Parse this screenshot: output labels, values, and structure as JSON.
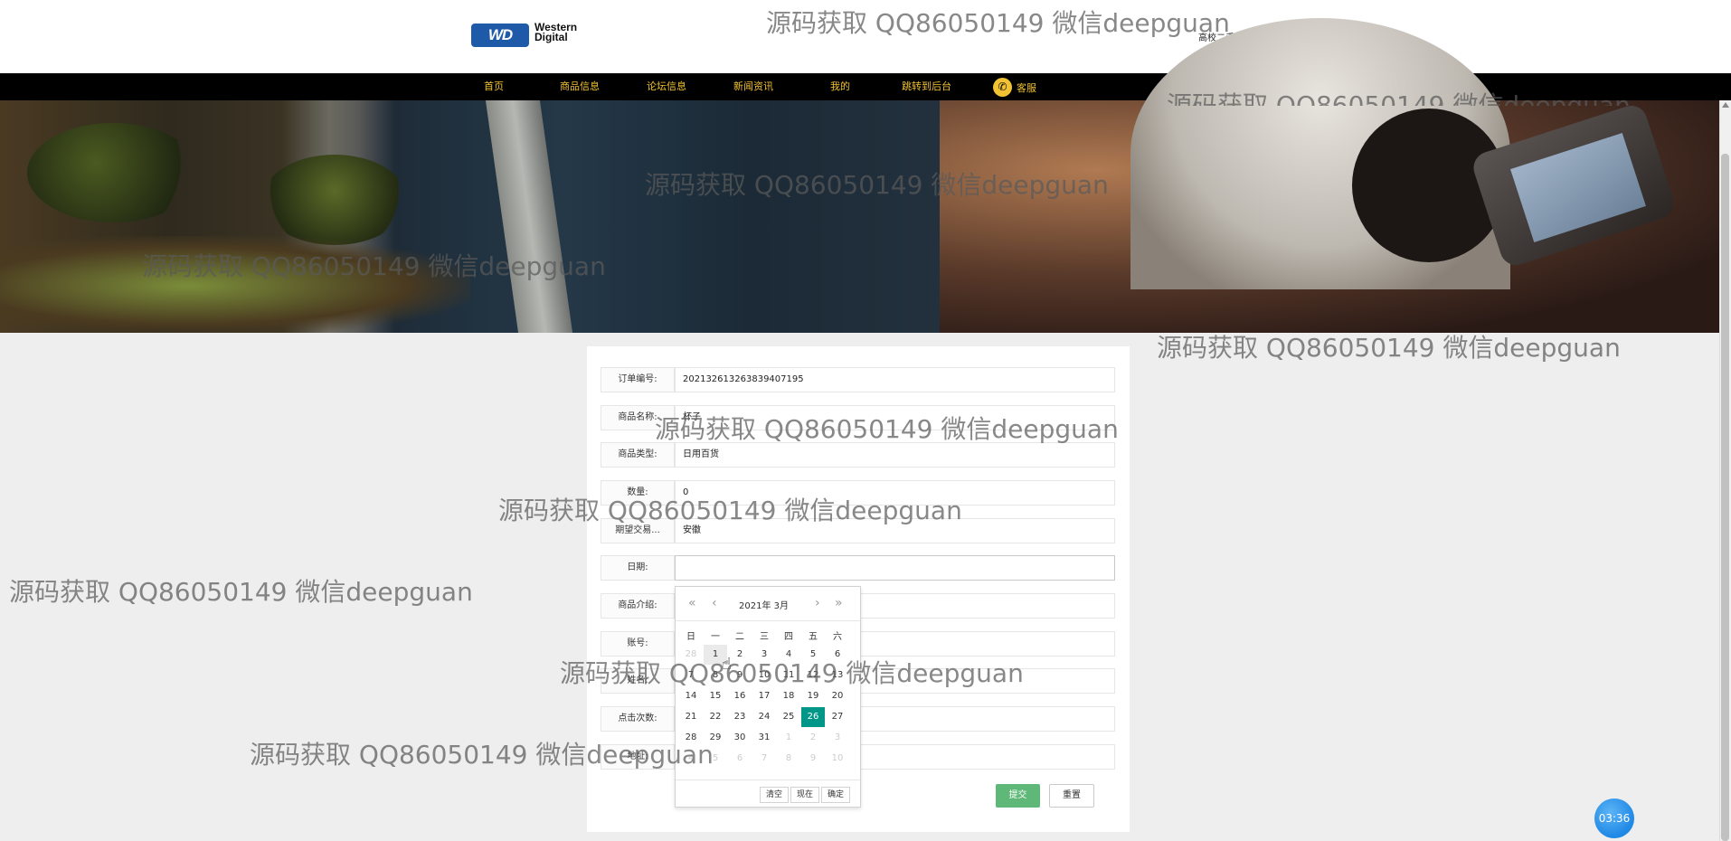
{
  "header": {
    "logo_text": "WD",
    "logo_brand_line1": "Western",
    "logo_brand_line2": "Digital",
    "site_name": "高校二手交易平台"
  },
  "nav": {
    "items": [
      {
        "label": "首页"
      },
      {
        "label": "商品信息"
      },
      {
        "label": "论坛信息"
      },
      {
        "label": "新闻资讯"
      },
      {
        "label": "我的"
      },
      {
        "label": "跳转到后台"
      }
    ],
    "service_label": "客服"
  },
  "form": {
    "fields": [
      {
        "label": "订单编号:",
        "value": "20213261326383940719​5"
      },
      {
        "label": "商品名称:",
        "value": "杯子"
      },
      {
        "label": "商品类型:",
        "value": "日用百货"
      },
      {
        "label": "数量:",
        "value": "0"
      },
      {
        "label": "期望交易...",
        "value": "安徽"
      },
      {
        "label": "日期:",
        "value": ""
      },
      {
        "label": "商品介绍:",
        "value": ""
      },
      {
        "label": "账号:",
        "value": ""
      },
      {
        "label": "姓名:",
        "value": ""
      },
      {
        "label": "点击次数:",
        "value": ""
      },
      {
        "label": "地址:",
        "value": ""
      }
    ],
    "submit_label": "提交",
    "reset_label": "重置"
  },
  "datepicker": {
    "title": "2021年  3月",
    "prev_year": "«",
    "prev_month": "‹",
    "next_month": "›",
    "next_year": "»",
    "weekdays": [
      "日",
      "一",
      "二",
      "三",
      "四",
      "五",
      "六"
    ],
    "weeks": [
      [
        {
          "d": "28",
          "o": true
        },
        {
          "d": "1",
          "h": true
        },
        {
          "d": "2"
        },
        {
          "d": "3"
        },
        {
          "d": "4"
        },
        {
          "d": "5"
        },
        {
          "d": "6"
        }
      ],
      [
        {
          "d": "7"
        },
        {
          "d": "8"
        },
        {
          "d": "9"
        },
        {
          "d": "10"
        },
        {
          "d": "11"
        },
        {
          "d": "12"
        },
        {
          "d": "13"
        }
      ],
      [
        {
          "d": "14"
        },
        {
          "d": "15"
        },
        {
          "d": "16"
        },
        {
          "d": "17"
        },
        {
          "d": "18"
        },
        {
          "d": "19"
        },
        {
          "d": "20"
        }
      ],
      [
        {
          "d": "21"
        },
        {
          "d": "22"
        },
        {
          "d": "23"
        },
        {
          "d": "24"
        },
        {
          "d": "25"
        },
        {
          "d": "26",
          "t": true
        },
        {
          "d": "27"
        }
      ],
      [
        {
          "d": "28"
        },
        {
          "d": "29"
        },
        {
          "d": "30"
        },
        {
          "d": "31"
        },
        {
          "d": "1",
          "o": true
        },
        {
          "d": "2",
          "o": true
        },
        {
          "d": "3",
          "o": true
        }
      ],
      [
        {
          "d": "4",
          "o": true
        },
        {
          "d": "5",
          "o": true
        },
        {
          "d": "6",
          "o": true
        },
        {
          "d": "7",
          "o": true
        },
        {
          "d": "8",
          "o": true
        },
        {
          "d": "9",
          "o": true
        },
        {
          "d": "10",
          "o": true
        }
      ]
    ],
    "clear_label": "清空",
    "now_label": "现在",
    "confirm_label": "确定"
  },
  "timer": "03:36",
  "watermark_text": "源码获取 QQ86050149 微信deepguan",
  "colors": {
    "nav_bg": "#000000",
    "nav_text": "#f1c232",
    "submit_bg": "#5fb878",
    "today_bg": "#009688",
    "timer_bg": "#1e88e5"
  }
}
